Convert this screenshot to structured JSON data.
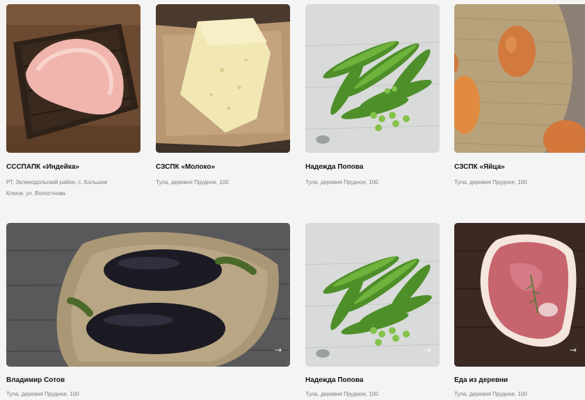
{
  "products": [
    {
      "title": "СССПАПК «Индейка»",
      "address": "РТ, Зеленодольский район, с. Большие Ключи, ул. Волостнова",
      "image": "turkey-meat"
    },
    {
      "title": "СЗСПК «Молоко»",
      "address": "Тула, деревня Прудное, 100",
      "image": "cheese"
    },
    {
      "title": "Надежда Попова",
      "address": "Тула, деревня Прудное, 100",
      "image": "green-peas"
    },
    {
      "title": "СЗСПК «Яйца»",
      "address": "Тула, деревня Прудное, 100",
      "image": "eggs"
    },
    {
      "title": "Владимир Сотов",
      "address": "Тула, деревня Прудное, 100",
      "image": "eggplants"
    },
    {
      "title": "Надежда Попова",
      "address": "Тула, деревня Прудное, 100",
      "image": "green-peas"
    },
    {
      "title": "Еда из деревни",
      "address": "Тула, деревня Прудное, 100",
      "image": "ham-steak"
    }
  ],
  "arrow_icon": "→"
}
